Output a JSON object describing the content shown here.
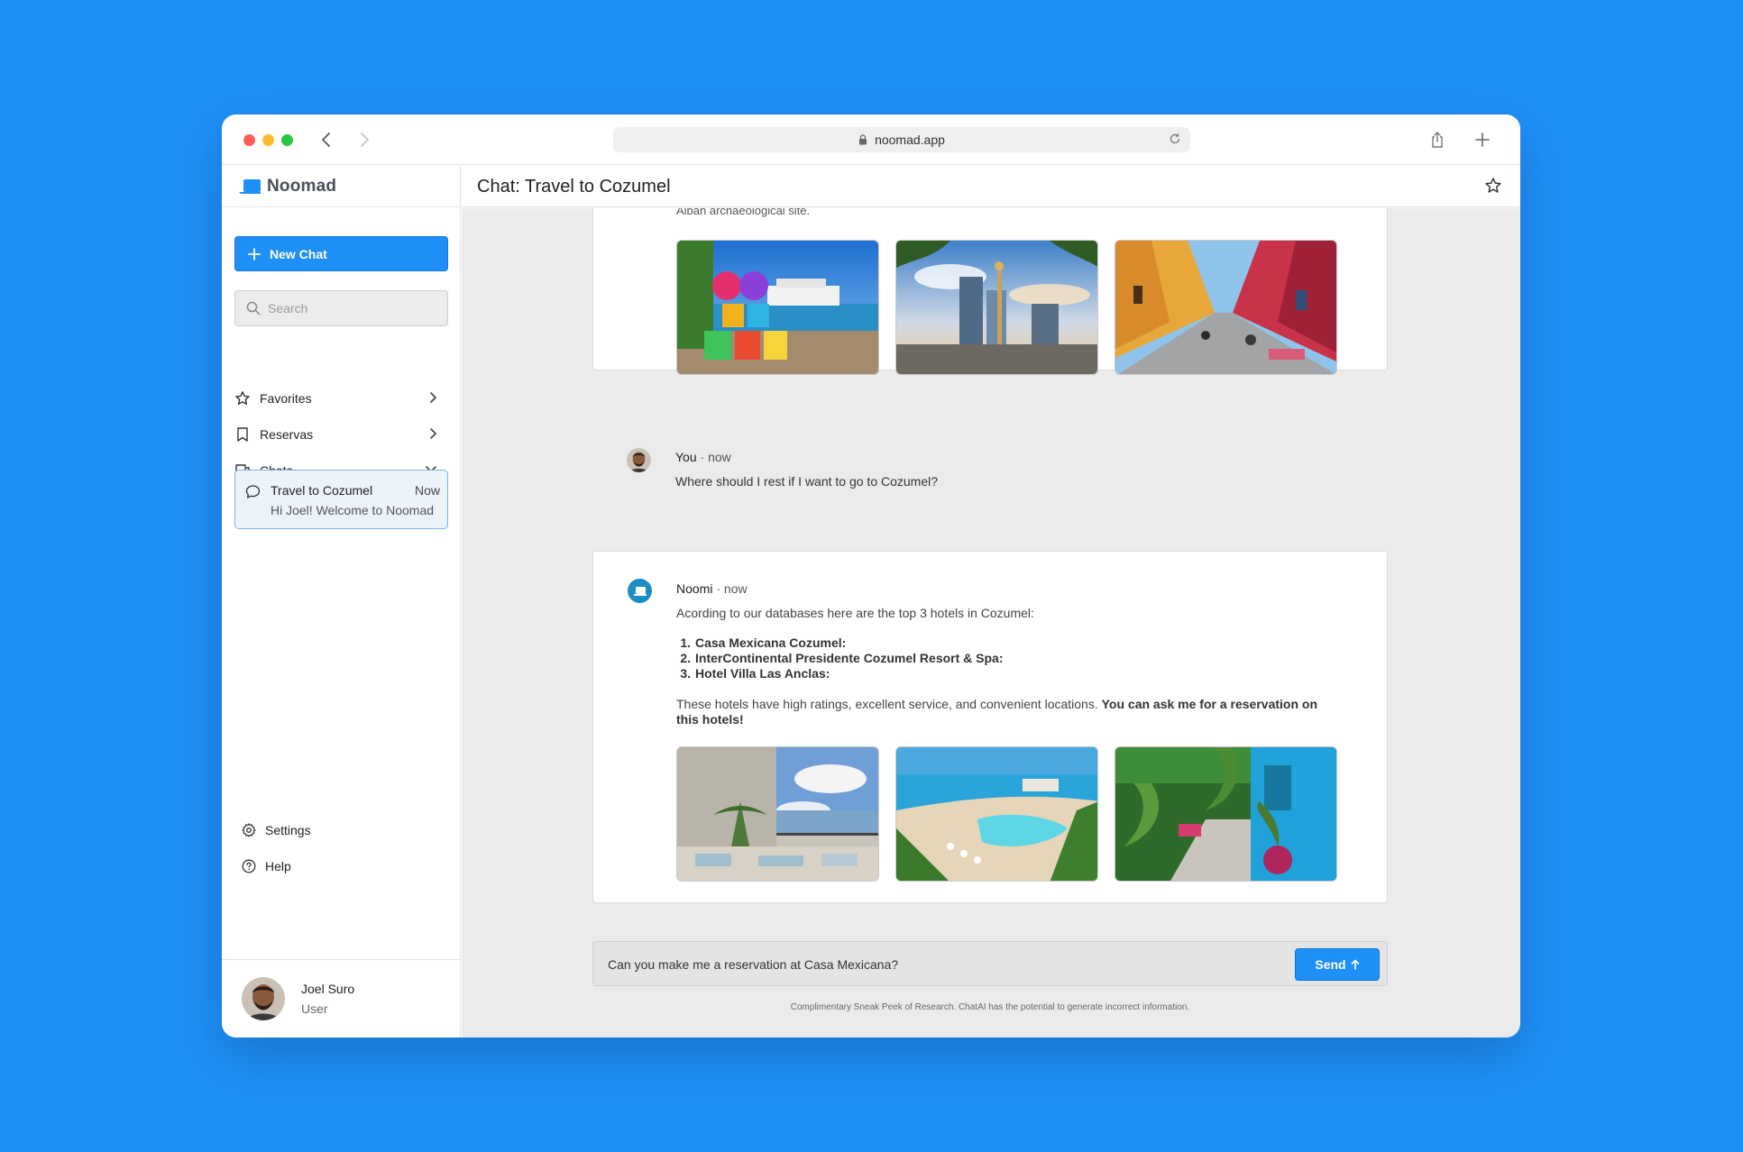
{
  "browser": {
    "url": "noomad.app"
  },
  "sidebar": {
    "brand": "Noomad",
    "new_chat_label": "New Chat",
    "search_placeholder": "Search",
    "nav": [
      {
        "label": "Favorites",
        "icon": "star-icon"
      },
      {
        "label": "Reservas",
        "icon": "bookmark-icon"
      },
      {
        "label": "Chats",
        "icon": "chat-bubbles-icon"
      }
    ],
    "chats": [
      {
        "title": "Travel to Cozumel",
        "time": "Now",
        "preview": "Hi Joel! Welcome to Noomad"
      }
    ],
    "footer": [
      {
        "label": "Settings",
        "icon": "gear-icon"
      },
      {
        "label": "Help",
        "icon": "help-icon"
      }
    ],
    "user": {
      "name": "Joel Suro",
      "role": "User"
    }
  },
  "header": {
    "title": "Chat: Travel to Cozumel"
  },
  "messages": {
    "previous_tail": "Alban archaeological site.",
    "user_msg": {
      "author": "You",
      "when": "· now",
      "text": "Where should I rest if I want to go to Cozumel?"
    },
    "bot_msg": {
      "author": "Noomi",
      "when": "· now",
      "intro": "Acording to our databases here are the top 3 hotels in Cozumel:",
      "hotels": [
        {
          "num": "1.",
          "name": "Casa Mexicana Cozumel:"
        },
        {
          "num": "2.",
          "name": "InterContinental Presidente Cozumel Resort & Spa:"
        },
        {
          "num": "3.",
          "name": "Hotel Villa Las Anclas:"
        }
      ],
      "summary_plain": "These hotels have high ratings, excellent service, and convenient locations.",
      "summary_bold": "You can ask me for a reservation on this hotels!"
    }
  },
  "composer": {
    "value": "Can you make me a reservation at Casa Mexicana?",
    "send_label": "Send"
  },
  "disclaimer": "Complimentary Sneak Peek of Research. ChatAI has the potential to generate incorrect information.",
  "colors": {
    "page_background": "#1e8ff7",
    "accent": "#1e8ff7",
    "chat_background": "#ebebeb",
    "bot_avatar": "#1b8ec4"
  }
}
